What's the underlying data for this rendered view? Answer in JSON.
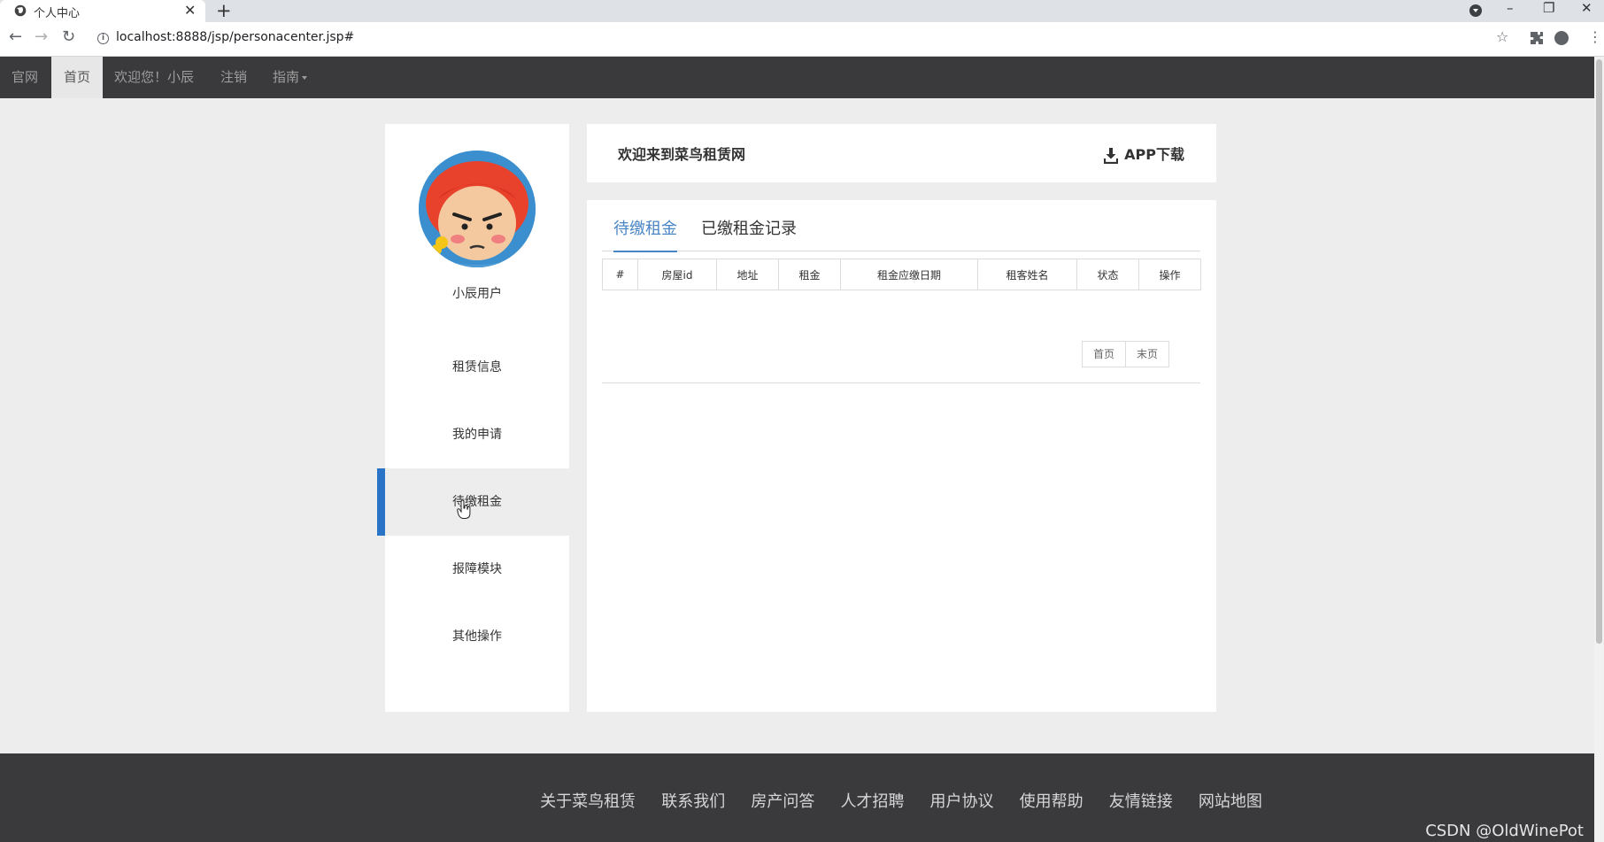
{
  "browser": {
    "tab_title": "个人中心",
    "tab_close": "✕",
    "new_tab": "+",
    "url": "localhost:8888/jsp/personacenter.jsp#",
    "window_controls": [
      "–",
      "❐",
      "✕"
    ],
    "back": "←",
    "forward": "→",
    "reload": "↻",
    "star": "☆",
    "menu": "⋮"
  },
  "navbar": {
    "brand": "官网",
    "home": "首页",
    "greeting": "欢迎您！小辰",
    "logout": "注销",
    "guide": "指南",
    "active_bg": "#e7e7e7"
  },
  "sidebar": {
    "username": "小辰用户",
    "menu": [
      "租赁信息",
      "我的申请",
      "待缴租金",
      "报障模块",
      "其他操作"
    ],
    "active_index": 2,
    "accent_color": "#2a74c8"
  },
  "header": {
    "welcome": "欢迎来到菜鸟租赁网",
    "app_download": "APP下载"
  },
  "tabs": {
    "pending": "待缴租金",
    "paid": "已缴租金记录",
    "active_color": "#4a86c5"
  },
  "table": {
    "columns": [
      "#",
      "房屋id",
      "地址",
      "租金",
      "租金应缴日期",
      "租客姓名",
      "状态",
      "操作"
    ],
    "rows": []
  },
  "pagination": {
    "first": "首页",
    "last": "末页"
  },
  "footer": {
    "links": [
      "关于菜鸟租赁",
      "联系我们",
      "房产问答",
      "人才招聘",
      "用户协议",
      "使用帮助",
      "友情链接",
      "网站地图"
    ],
    "watermark": "CSDN @OldWinePot"
  }
}
